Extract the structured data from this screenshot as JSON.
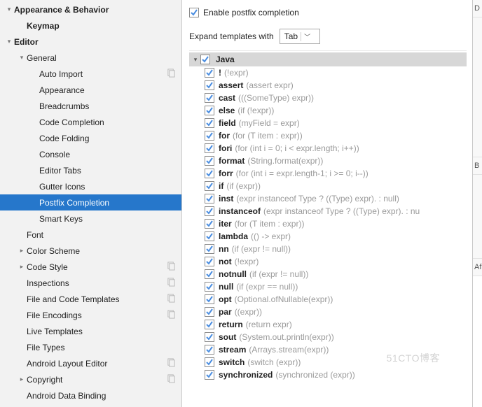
{
  "sidebar": [
    {
      "label": "Appearance & Behavior",
      "bold": true,
      "indent": 0,
      "arrow": "down",
      "copy": false
    },
    {
      "label": "Keymap",
      "bold": true,
      "indent": 1,
      "arrow": "",
      "copy": false
    },
    {
      "label": "Editor",
      "bold": true,
      "indent": 0,
      "arrow": "down",
      "copy": false
    },
    {
      "label": "General",
      "bold": false,
      "indent": 1,
      "arrow": "down",
      "copy": false
    },
    {
      "label": "Auto Import",
      "bold": false,
      "indent": 2,
      "arrow": "",
      "copy": true
    },
    {
      "label": "Appearance",
      "bold": false,
      "indent": 2,
      "arrow": "",
      "copy": false
    },
    {
      "label": "Breadcrumbs",
      "bold": false,
      "indent": 2,
      "arrow": "",
      "copy": false
    },
    {
      "label": "Code Completion",
      "bold": false,
      "indent": 2,
      "arrow": "",
      "copy": false
    },
    {
      "label": "Code Folding",
      "bold": false,
      "indent": 2,
      "arrow": "",
      "copy": false
    },
    {
      "label": "Console",
      "bold": false,
      "indent": 2,
      "arrow": "",
      "copy": false
    },
    {
      "label": "Editor Tabs",
      "bold": false,
      "indent": 2,
      "arrow": "",
      "copy": false
    },
    {
      "label": "Gutter Icons",
      "bold": false,
      "indent": 2,
      "arrow": "",
      "copy": false
    },
    {
      "label": "Postfix Completion",
      "bold": false,
      "indent": 2,
      "arrow": "",
      "copy": false,
      "selected": true
    },
    {
      "label": "Smart Keys",
      "bold": false,
      "indent": 2,
      "arrow": "",
      "copy": false
    },
    {
      "label": "Font",
      "bold": false,
      "indent": 1,
      "arrow": "",
      "copy": false
    },
    {
      "label": "Color Scheme",
      "bold": false,
      "indent": 1,
      "arrow": "right",
      "copy": false
    },
    {
      "label": "Code Style",
      "bold": false,
      "indent": 1,
      "arrow": "right",
      "copy": true
    },
    {
      "label": "Inspections",
      "bold": false,
      "indent": 1,
      "arrow": "",
      "copy": true
    },
    {
      "label": "File and Code Templates",
      "bold": false,
      "indent": 1,
      "arrow": "",
      "copy": true
    },
    {
      "label": "File Encodings",
      "bold": false,
      "indent": 1,
      "arrow": "",
      "copy": true
    },
    {
      "label": "Live Templates",
      "bold": false,
      "indent": 1,
      "arrow": "",
      "copy": false
    },
    {
      "label": "File Types",
      "bold": false,
      "indent": 1,
      "arrow": "",
      "copy": false
    },
    {
      "label": "Android Layout Editor",
      "bold": false,
      "indent": 1,
      "arrow": "",
      "copy": true
    },
    {
      "label": "Copyright",
      "bold": false,
      "indent": 1,
      "arrow": "right",
      "copy": true
    },
    {
      "label": "Android Data Binding",
      "bold": false,
      "indent": 1,
      "arrow": "",
      "copy": false
    }
  ],
  "header": {
    "enable_label": "Enable postfix completion",
    "enable_checked": true,
    "expand_label": "Expand templates with",
    "expand_value": "Tab"
  },
  "tree": {
    "root_label": "Java",
    "root_checked": true,
    "items": [
      {
        "name": "!",
        "example": "(!expr)"
      },
      {
        "name": "assert",
        "example": "(assert expr)"
      },
      {
        "name": "cast",
        "example": "(((SomeType) expr))"
      },
      {
        "name": "else",
        "example": "(if (!expr))"
      },
      {
        "name": "field",
        "example": "(myField = expr)"
      },
      {
        "name": "for",
        "example": "(for (T item : expr))"
      },
      {
        "name": "fori",
        "example": "(for (int i = 0; i < expr.length; i++))"
      },
      {
        "name": "format",
        "example": "(String.format(expr))"
      },
      {
        "name": "forr",
        "example": "(for (int i = expr.length-1; i >= 0; i--))"
      },
      {
        "name": "if",
        "example": "(if (expr))"
      },
      {
        "name": "inst",
        "example": "(expr instanceof Type ? ((Type) expr). : null)"
      },
      {
        "name": "instanceof",
        "example": "(expr instanceof Type ? ((Type) expr). : nu"
      },
      {
        "name": "iter",
        "example": "(for (T item : expr))"
      },
      {
        "name": "lambda",
        "example": "(() -> expr)"
      },
      {
        "name": "nn",
        "example": "(if (expr != null))"
      },
      {
        "name": "not",
        "example": "(!expr)"
      },
      {
        "name": "notnull",
        "example": "(if (expr != null))"
      },
      {
        "name": "null",
        "example": "(if (expr == null))"
      },
      {
        "name": "opt",
        "example": "(Optional.ofNullable(expr))"
      },
      {
        "name": "par",
        "example": "((expr))"
      },
      {
        "name": "return",
        "example": "(return expr)"
      },
      {
        "name": "sout",
        "example": "(System.out.println(expr))"
      },
      {
        "name": "stream",
        "example": "(Arrays.stream(expr))"
      },
      {
        "name": "switch",
        "example": "(switch (expr))"
      },
      {
        "name": "synchronized",
        "example": "(synchronized (expr))"
      }
    ]
  },
  "right_panel": {
    "d": "D",
    "b": "B",
    "a": "Af"
  },
  "watermark": "51CTO博客"
}
